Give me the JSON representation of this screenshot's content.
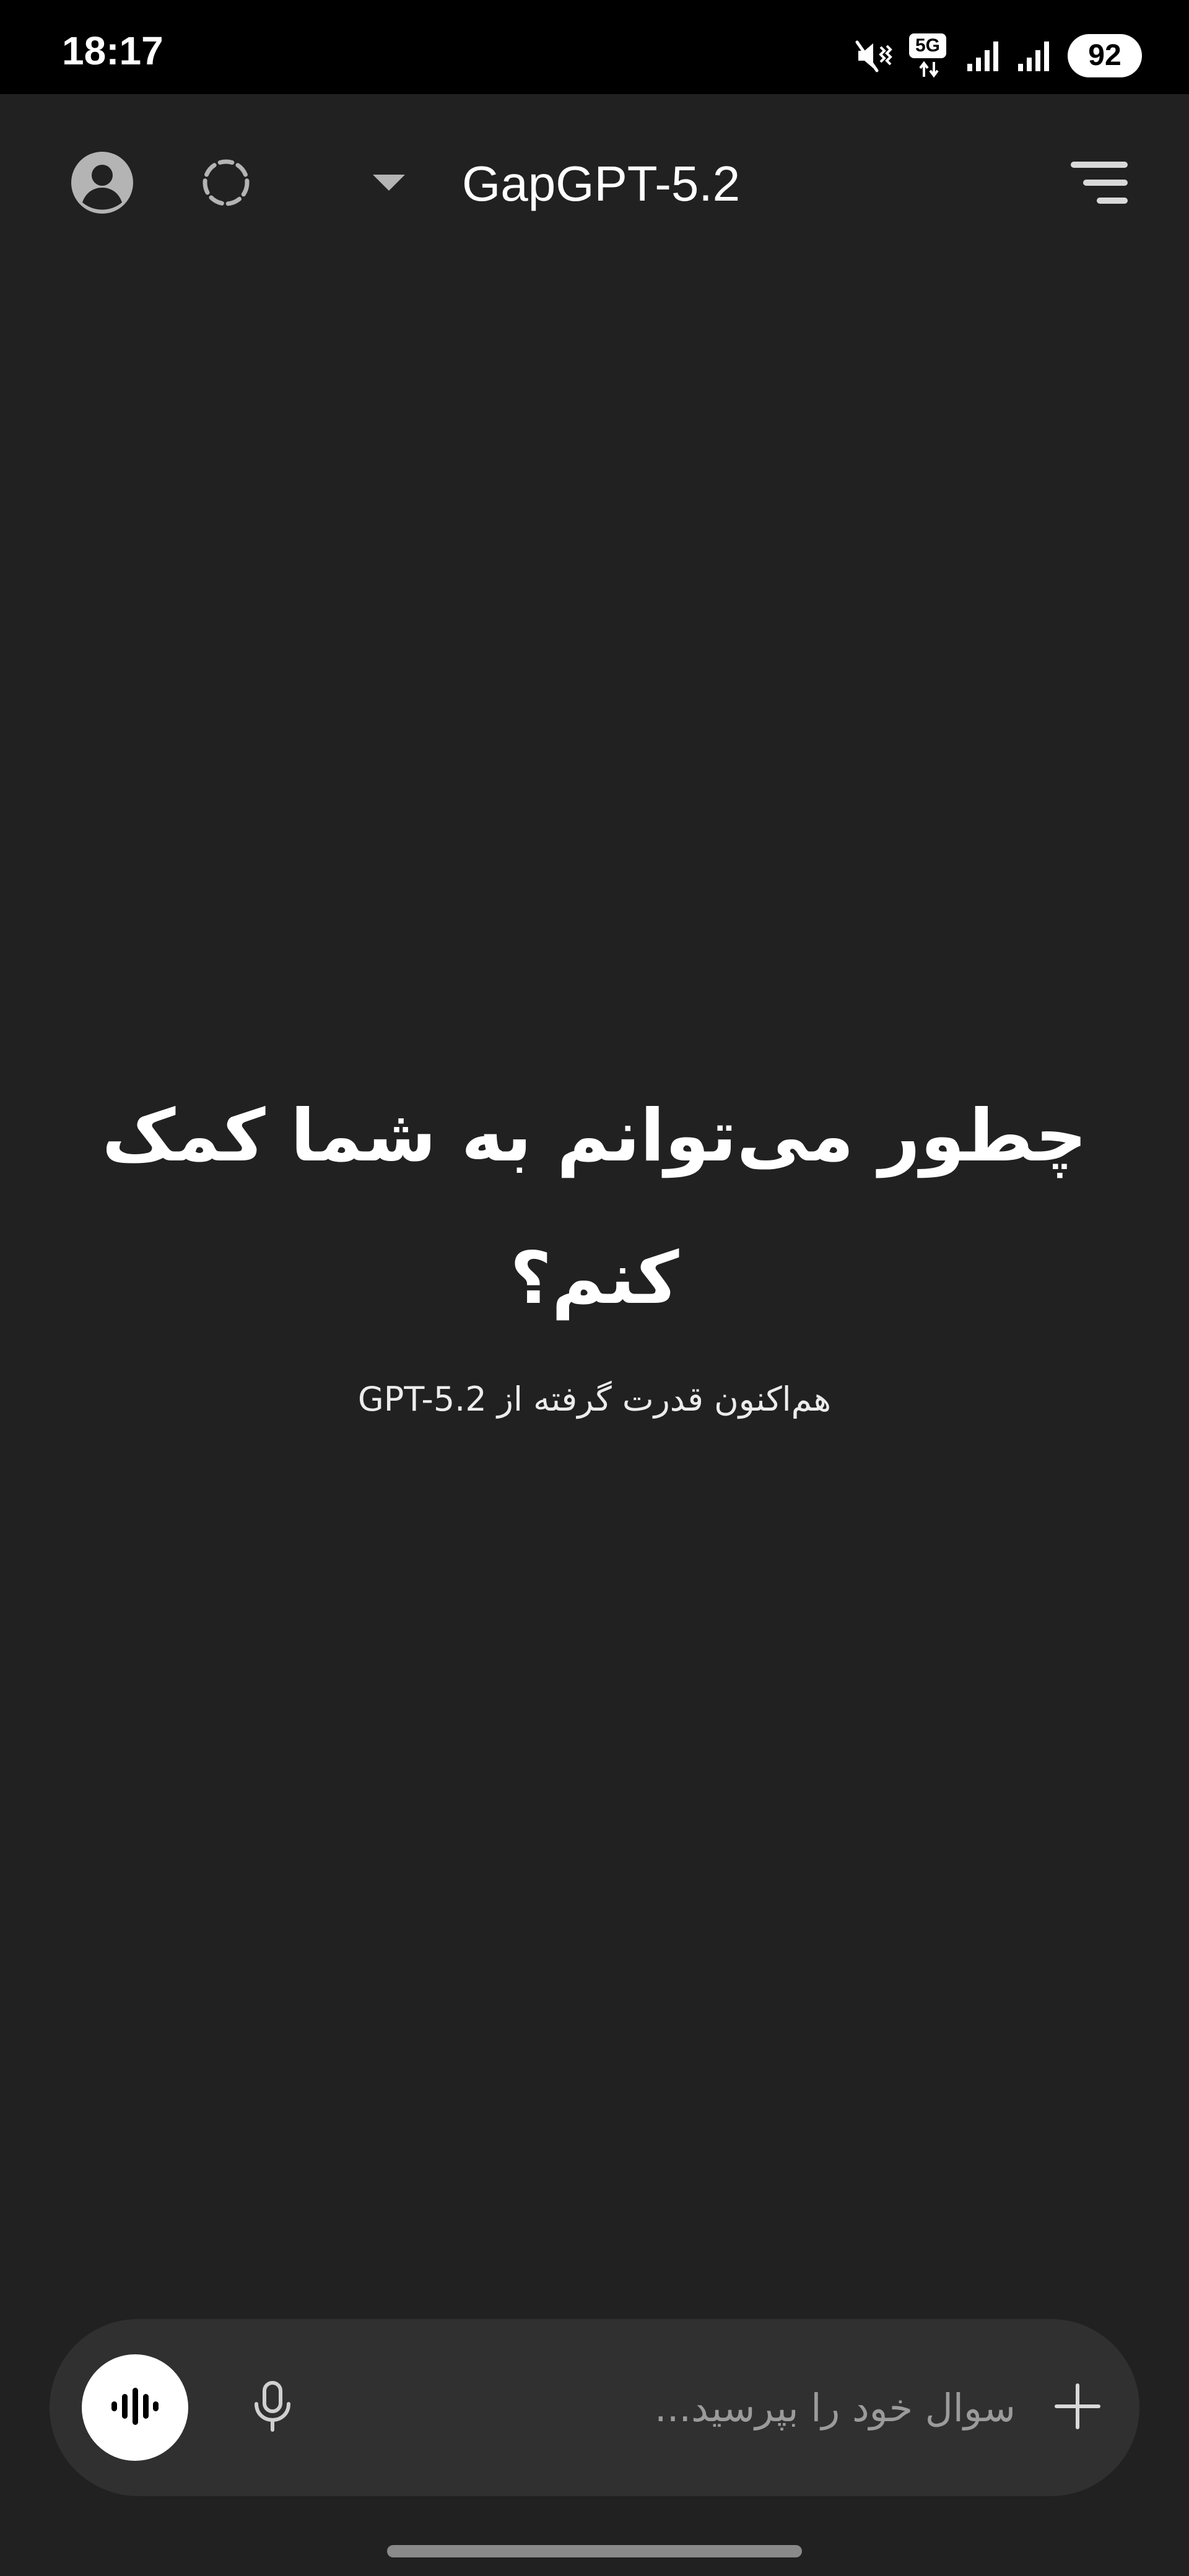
{
  "status_bar": {
    "time": "18:17",
    "network": "5G",
    "battery": "92",
    "icons": [
      "mute-vibrate-icon",
      "network-5g-icon",
      "signal-icon",
      "signal-icon",
      "battery-icon"
    ]
  },
  "header": {
    "model_name": "GapGPT-5.2",
    "icons": {
      "profile": "profile-icon",
      "temporary_chat": "temporary-chat-icon",
      "model_dropdown": "chevron-down-icon",
      "menu": "menu-icon"
    }
  },
  "greeting": {
    "title": "چطور می‌توانم به شما کمک کنم؟",
    "subtitle": "هم‌اکنون قدرت گرفته از GPT-5.2"
  },
  "composer": {
    "placeholder": "سوال خود را بپرسید...",
    "value": "",
    "icons": {
      "voice": "voice-waveform-icon",
      "mic": "microphone-icon",
      "add": "plus-icon"
    }
  },
  "colors": {
    "background": "#212121",
    "status_bar": "#000000",
    "composer": "#303030",
    "text": "#ffffff",
    "placeholder": "#9b9b9b",
    "icon": "#b4b4b4"
  }
}
